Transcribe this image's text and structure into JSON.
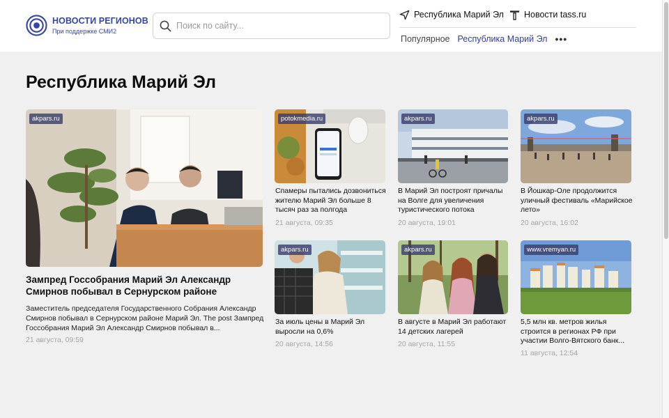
{
  "header": {
    "logo_title": "НОВОСТИ РЕГИОНОВ",
    "logo_subtitle": "При поддержке СМИ2",
    "search_placeholder": "Поиск по сайту...",
    "location_link": "Республика Марий Эл",
    "tass_link": "Новости tass.ru",
    "nav": [
      {
        "label": "Популярное",
        "active": false
      },
      {
        "label": "Республика Марий Эл",
        "active": true
      }
    ],
    "nav_more": "•••"
  },
  "page_title": "Республика Марий Эл",
  "lead": {
    "source": "akpars.ru",
    "title": "Зампред Госсобрания Марий Эл Александр Смирнов побывал в Сернурском районе",
    "excerpt": "Заместитель председателя Государственного Собрания Александр Смирнов побывал в Сернурском районе Марий Эл. The post Зампред Госсобрания Марий Эл Александр Смирнов побывал в...",
    "date": "21 августа, 09:59"
  },
  "cards": [
    {
      "source": "potokmedia.ru",
      "title": "Спамеры пытались дозвониться жителю Марий Эл больше 8 тысяч раз за полгода",
      "date": "21 августа, 09:35"
    },
    {
      "source": "akpars.ru",
      "title": "В Марий Эл построят причалы на Волге для увеличения туристического потока",
      "date": "20 августа, 19:01"
    },
    {
      "source": "akpars.ru",
      "title": "В Йошкар-Оле продолжится уличный фестиваль «Марийское лето»",
      "date": "20 августа, 16:02"
    },
    {
      "source": "akpars.ru",
      "title": "За июль цены в Марий Эл выросли на 0,6%",
      "date": "20 августа, 14:56"
    },
    {
      "source": "akpars.ru",
      "title": "В августе в Марий Эл работают 14 детских лагерей",
      "date": "20 августа, 11:55"
    },
    {
      "source": "www.vremyan.ru",
      "title": "5,5 млн кв. метров жилья строится в регионах РФ при участии Волго-Вятского банк...",
      "date": "11 августа, 12:54"
    }
  ],
  "colors": {
    "brand": "#3545a8",
    "active_nav": "#2f3d9e",
    "page_background": "#f0f0f0",
    "date_text": "#a6a6a6"
  },
  "icons": [
    "logo-rings-icon",
    "search-icon",
    "location-arrow-icon",
    "tass-logo-icon",
    "more-dots-icon"
  ]
}
